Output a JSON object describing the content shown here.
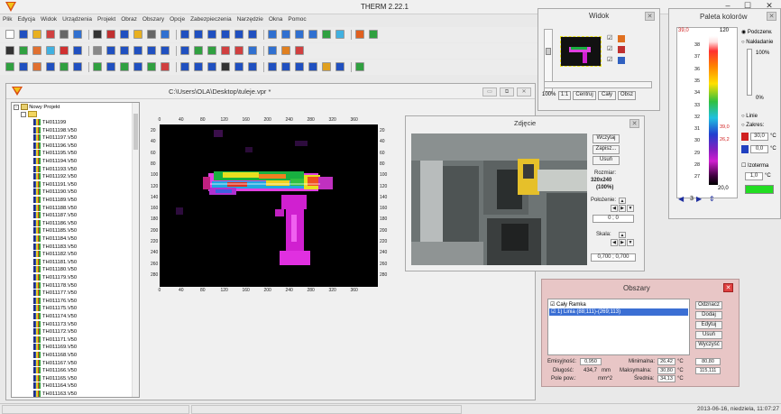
{
  "app": {
    "title": "THERM 2.22.1"
  },
  "menu": [
    "Plik",
    "Edycja",
    "Widok",
    "Urządzenia",
    "Projekt",
    "Obraz",
    "Obszary",
    "Opcje",
    "Zabezpieczenia",
    "Narzędzie",
    "Okna",
    "Pomoc"
  ],
  "project_window": {
    "title": "C:\\Users\\OLA\\Desktop\\tuleje.vpr *",
    "tree_root": "Nowy Projekt",
    "files": [
      "TH011199",
      "TH011198.V50",
      "TH011197.V50",
      "TH011196.V50",
      "TH011195.V50",
      "TH011194.V50",
      "TH011193.V50",
      "TH011192.V50",
      "TH011191.V50",
      "TH011190.V50",
      "TH011189.V50",
      "TH011188.V50",
      "TH011187.V50",
      "TH011186.V50",
      "TH011185.V50",
      "TH011184.V50",
      "TH011183.V50",
      "TH011182.V50",
      "TH011181.V50",
      "TH011180.V50",
      "TH011179.V50",
      "TH011178.V50",
      "TH011177.V50",
      "TH011176.V50",
      "TH011175.V50",
      "TH011174.V50",
      "TH011173.V50",
      "TH011172.V50",
      "TH011171.V50",
      "TH011169.V50",
      "TH011168.V50",
      "TH011167.V50",
      "TH011166.V50",
      "TH011165.V50",
      "TH011164.V50",
      "TH011163.V50"
    ],
    "x_ticks": [
      "0",
      "40",
      "80",
      "120",
      "160",
      "200",
      "240",
      "280",
      "320",
      "360"
    ],
    "y_ticks_left": [
      "20",
      "40",
      "60",
      "80",
      "100",
      "120",
      "140",
      "160",
      "180",
      "200",
      "220",
      "240",
      "260",
      "280"
    ],
    "y_ticks_right": [
      "20",
      "40",
      "60",
      "80",
      "100",
      "120",
      "140",
      "160",
      "180",
      "200",
      "220",
      "240",
      "260",
      "280"
    ]
  },
  "photo_window": {
    "title": "Zdjęcie",
    "load": "Wczytaj",
    "save": "Zapisz...",
    "delete": "Usuń",
    "size_label": "Rozmiar:",
    "size_value": "320x240",
    "size_pct": "(100%)",
    "position_label": "Położenie:",
    "position_value": "0 ; 0",
    "scale_label": "Skala:",
    "scale_value": "0,700 ; 0,700"
  },
  "widok_window": {
    "title": "Widok",
    "zoom": "100%",
    "btn_11": "1:1",
    "btn_center": "Centruj",
    "btn_whole": "Cały",
    "btn_obsz": "Obsz"
  },
  "paleta_window": {
    "title": "Paleta kolorów",
    "scale_top": "39,0",
    "scale_top2": "120",
    "scale_bottom": "20,0",
    "ticks": [
      "38",
      "37",
      "36",
      "35",
      "34",
      "33",
      "32",
      "31",
      "30",
      "29",
      "28",
      "27"
    ],
    "marker_a": "39,0",
    "marker_b": "26,2",
    "opt_under": "Podczerw.",
    "opt_overlay": "Nakładanie",
    "overlay_pct": "100%",
    "zero_pct": "0%",
    "line_label": "Linie",
    "range_label": "Zakres:",
    "range_hi": "30,0",
    "range_lo": "0,0",
    "unit": "°C",
    "iso_label": "Izoterma",
    "iso_value": "1,0",
    "nav_value": "3"
  },
  "obszary_window": {
    "title": "Obszary",
    "list_header": "Cały Ramka",
    "list_row": "1) Linia (88;111)-(269;113)",
    "btn_remove": "Odznacz",
    "btn_add": "Dodaj",
    "btn_edit": "Edytuj",
    "btn_delete": "Usuń",
    "btn_clear": "Wyczyść",
    "emis_label": "Emisyjność:",
    "emis_value": "0,950",
    "len_label": "Długość:",
    "len_value": "434,7",
    "len_unit": "mm",
    "area_label": "Pole pow.:",
    "area_unit": "mm^2",
    "min_label": "Minimalna:",
    "min_value": "26,42",
    "max_label": "Maksymalna:",
    "max_value": "30,80",
    "avg_label": "Średnia:",
    "avg_value": "34,13",
    "unit": "°C",
    "col3_a": "80,80",
    "col3_b": "115,111"
  },
  "status": {
    "datetime": "2013-06-16, niedziela, 11:07:27"
  }
}
